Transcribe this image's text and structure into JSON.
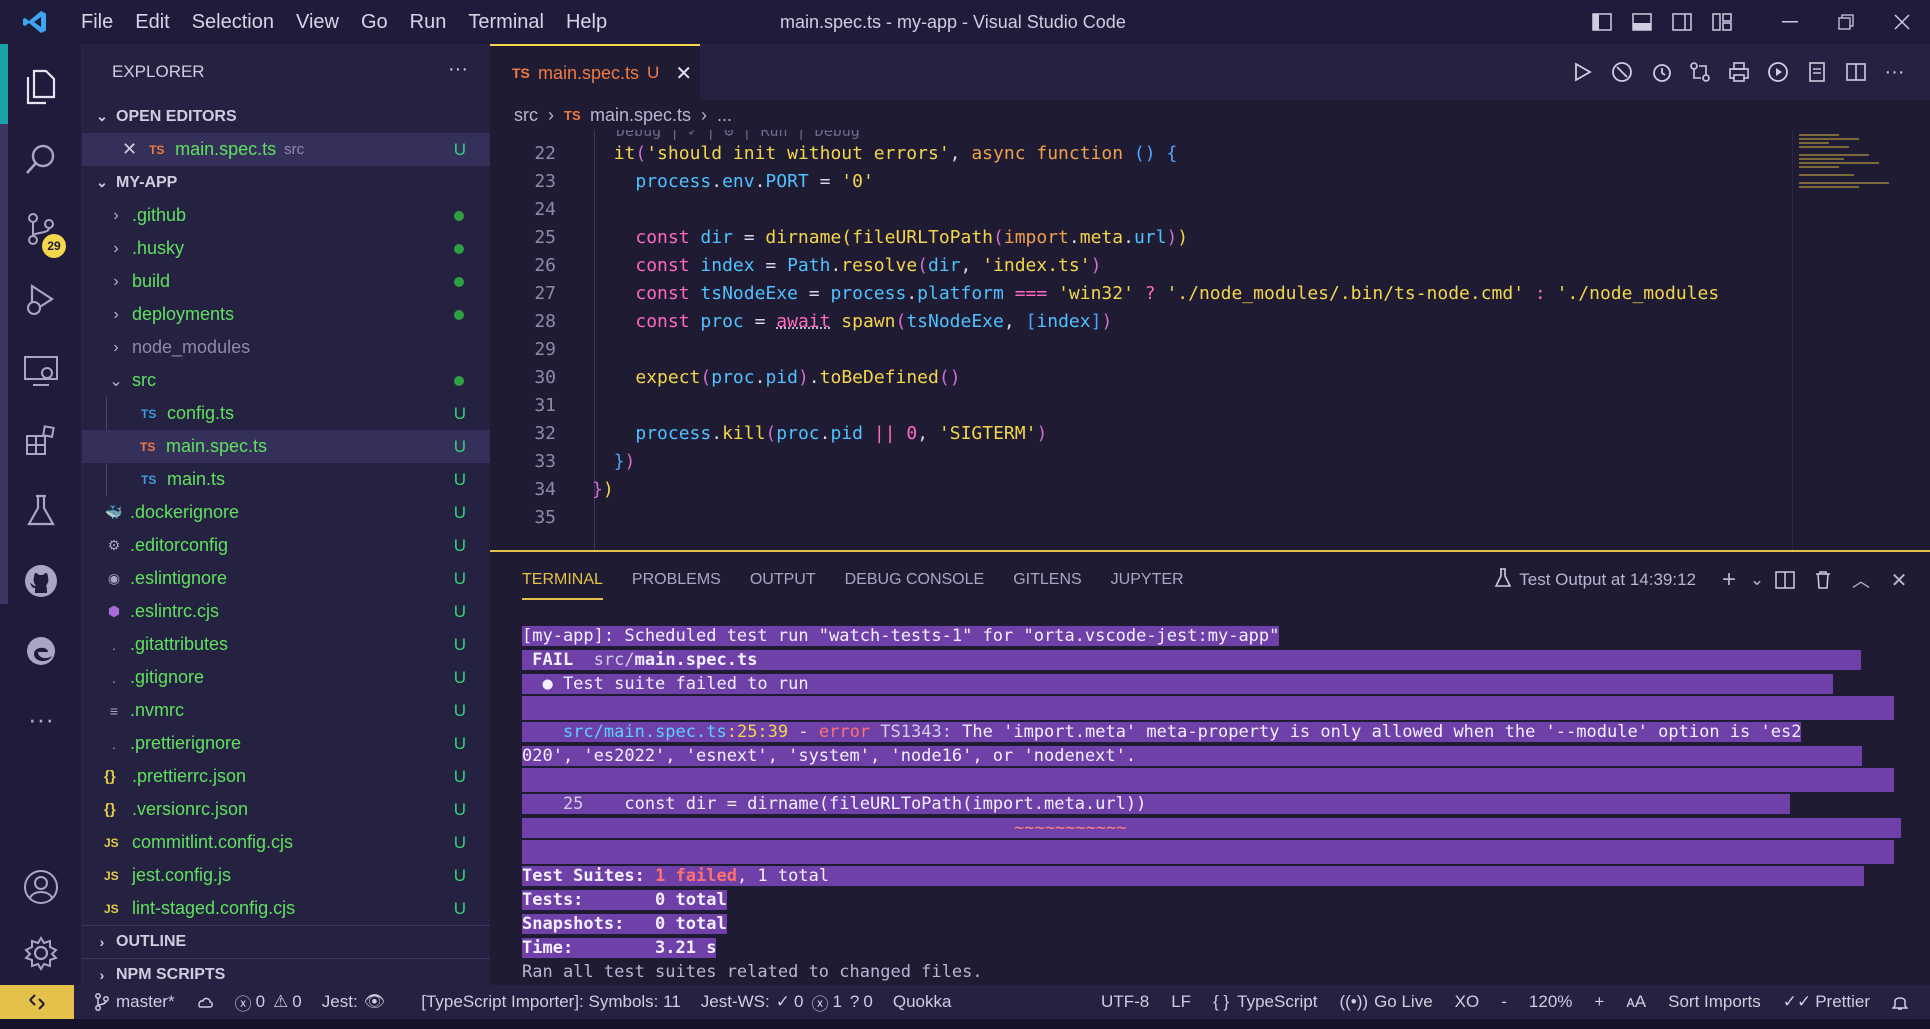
{
  "window": {
    "title": "main.spec.ts - my-app - Visual Studio Code"
  },
  "menu": [
    "File",
    "Edit",
    "Selection",
    "View",
    "Go",
    "Run",
    "Terminal",
    "Help"
  ],
  "activity": {
    "scm_badge": "29"
  },
  "sidebar": {
    "header": "EXPLORER",
    "open_editors_title": "OPEN EDITORS",
    "open_editor": {
      "icon": "TS",
      "name": "main.spec.ts",
      "folder": "src",
      "status": "U"
    },
    "project_title": "MY-APP",
    "tree": [
      {
        "name": ".github",
        "type": "folder",
        "status": "dot"
      },
      {
        "name": ".husky",
        "type": "folder",
        "status": "dot"
      },
      {
        "name": "build",
        "type": "folder",
        "status": "dot"
      },
      {
        "name": "deployments",
        "type": "folder",
        "status": "dot"
      },
      {
        "name": "node_modules",
        "type": "folder",
        "status": ""
      },
      {
        "name": "src",
        "type": "folder-open",
        "status": "dot"
      },
      {
        "name": "config.ts",
        "type": "ts",
        "status": "U"
      },
      {
        "name": "main.spec.ts",
        "type": "ts-active",
        "status": "U"
      },
      {
        "name": "main.ts",
        "type": "ts",
        "status": "U"
      },
      {
        "name": ".dockerignore",
        "type": "file",
        "status": "U"
      },
      {
        "name": ".editorconfig",
        "type": "file",
        "status": "U"
      },
      {
        "name": ".eslintignore",
        "type": "file",
        "status": "U"
      },
      {
        "name": ".eslintrc.cjs",
        "type": "file",
        "status": "U"
      },
      {
        "name": ".gitattributes",
        "type": "file",
        "status": "U"
      },
      {
        "name": ".gitignore",
        "type": "file",
        "status": "U"
      },
      {
        "name": ".nvmrc",
        "type": "file",
        "status": "U"
      },
      {
        "name": ".prettierignore",
        "type": "file",
        "status": "U"
      },
      {
        "name": ".prettierrc.json",
        "type": "json",
        "status": "U"
      },
      {
        "name": ".versionrc.json",
        "type": "json",
        "status": "U"
      },
      {
        "name": "commitlint.config.cjs",
        "type": "js",
        "status": "U"
      },
      {
        "name": "jest.config.js",
        "type": "js",
        "status": "U"
      },
      {
        "name": "lint-staged.config.cjs",
        "type": "js",
        "status": "U"
      }
    ],
    "outline_title": "OUTLINE",
    "npm_title": "NPM SCRIPTS"
  },
  "tab": {
    "icon": "TS",
    "label": "main.spec.ts",
    "status": "U"
  },
  "breadcrumb": {
    "folder": "src",
    "icon": "TS",
    "file": "main.spec.ts",
    "more": "..."
  },
  "editor": {
    "codelens": "Debug | ✓ | ⚙ | Run | Debug",
    "line_numbers": [
      "22",
      "23",
      "24",
      "25",
      "26",
      "27",
      "28",
      "29",
      "30",
      "31",
      "32",
      "33",
      "34",
      "35"
    ]
  },
  "panel": {
    "tabs": [
      "TERMINAL",
      "PROBLEMS",
      "OUTPUT",
      "DEBUG CONSOLE",
      "GITLENS",
      "JUPYTER"
    ],
    "test_output": "Test Output at 14:39:12"
  },
  "terminal": {
    "l1": "[my-app]: Scheduled test run \"watch-tests-1\" for \"orta.vscode-jest:my-app\"",
    "fail": " FAIL ",
    "fail_path_dir": " src/",
    "fail_path_file": "main.spec.ts",
    "suite_failed": "  ● Test suite failed to run",
    "err_file": "src/main.spec.ts",
    "err_loc": ":25:39",
    "err_dash": " - ",
    "err_word": "error",
    "err_code": " TS1343:",
    "err_msg": " The 'import.meta' meta-property is only allowed when the '--module' option is 'es2",
    "err_msg2": "020', 'es2022', 'esnext', 'system', 'node16', or 'nodenext'.",
    "code_ln": "    25",
    "code_text": "    const dir = dirname(fileURLToPath(import.meta.url))",
    "squiggle": "~~~~~~~~~~~",
    "suites_label": "Test Suites: ",
    "suites_failed": "1 failed",
    "suites_rest": ", 1 total",
    "tests": "Tests:       0 total",
    "snapshots": "Snapshots:   0 total",
    "time": "Time:        3.21 s",
    "ran_all": "Ran all test suites related to changed files."
  },
  "status": {
    "branch": "master*",
    "problems_errors": "0",
    "problems_warnings": "0",
    "jest": "Jest:",
    "ts_importer": "[TypeScript Importer]: Symbols: 11",
    "jest_ws": "Jest-WS:",
    "jest_ws_pass": "0",
    "jest_ws_fail": "1",
    "jest_ws_unknown": "0",
    "quokka": "Quokka",
    "encoding": "UTF-8",
    "eol": "LF",
    "language": "TypeScript",
    "go_live": "Go Live",
    "xo": "XO",
    "zoom_minus": "-",
    "zoom": "120%",
    "zoom_plus": "+",
    "sort_imports": "Sort Imports",
    "prettier": "Prettier"
  },
  "colors": {
    "accent": "#e3c14b",
    "bg": "#1e1b33",
    "sidebar": "#252140",
    "terminal_highlight": "#6f41a8",
    "git_added": "#5fe15f"
  }
}
